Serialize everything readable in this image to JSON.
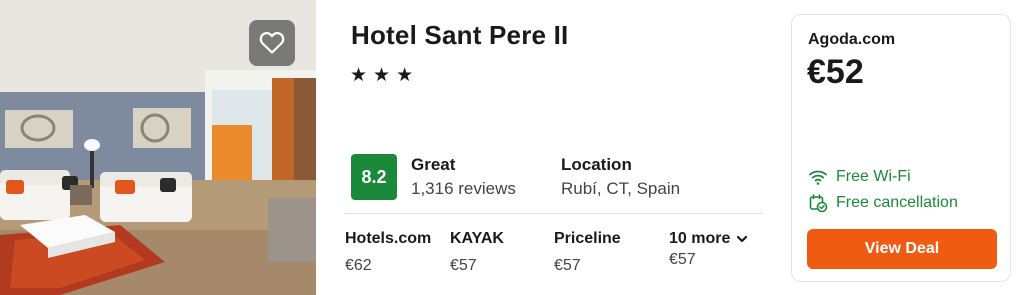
{
  "hotel": {
    "name": "Hotel Sant Pere II",
    "stars_text": "★★★",
    "star_count": 3
  },
  "rating": {
    "score": "8.2",
    "label": "Great",
    "reviews": "1,316 reviews"
  },
  "location": {
    "label": "Location",
    "value": "Rubí, CT, Spain"
  },
  "offers": [
    {
      "provider": "Hotels.com",
      "price": "€62"
    },
    {
      "provider": "KAYAK",
      "price": "€57"
    },
    {
      "provider": "Priceline",
      "price": "€57"
    }
  ],
  "more_offers": {
    "label": "10 more",
    "price": "€57"
  },
  "deal": {
    "provider": "Agoda.com",
    "price": "€52",
    "amenities": [
      "Free Wi-Fi",
      "Free cancellation"
    ],
    "button_label": "View Deal"
  },
  "icons": {
    "favorite": "heart-icon",
    "wifi": "wifi-icon",
    "cancellation": "cancellation-icon",
    "more": "chevron-down-icon"
  },
  "colors": {
    "rating_badge": "#1a8a3a",
    "amenity_text": "#1a8a3a",
    "deal_button": "#f05b14"
  }
}
